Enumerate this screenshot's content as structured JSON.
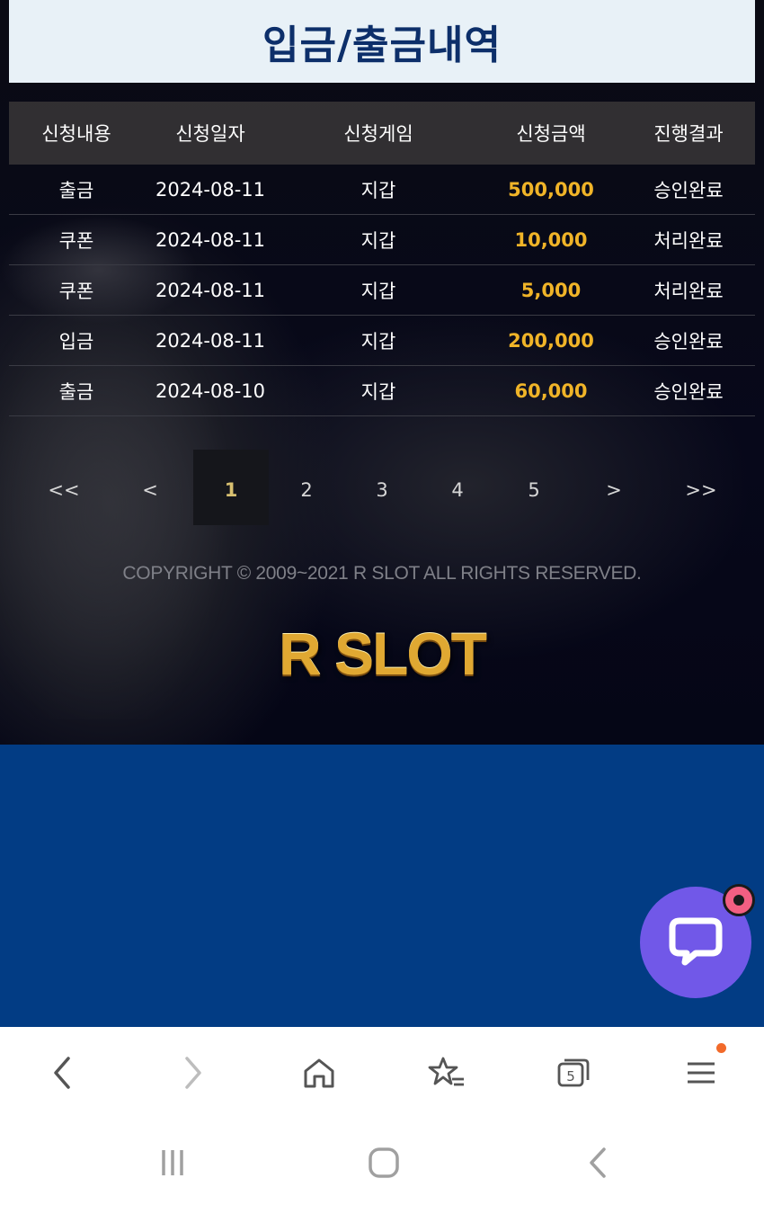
{
  "page_title": "입금/출금내역",
  "table": {
    "headers": [
      "신청내용",
      "신청일자",
      "신청게임",
      "신청금액",
      "진행결과"
    ],
    "rows": [
      {
        "type": "출금",
        "date": "2024-08-11",
        "game": "지갑",
        "amount": "500,000",
        "result": "승인완료"
      },
      {
        "type": "쿠폰",
        "date": "2024-08-11",
        "game": "지갑",
        "amount": "10,000",
        "result": "처리완료"
      },
      {
        "type": "쿠폰",
        "date": "2024-08-11",
        "game": "지갑",
        "amount": "5,000",
        "result": "처리완료"
      },
      {
        "type": "입금",
        "date": "2024-08-11",
        "game": "지갑",
        "amount": "200,000",
        "result": "승인완료"
      },
      {
        "type": "출금",
        "date": "2024-08-10",
        "game": "지갑",
        "amount": "60,000",
        "result": "승인완료"
      }
    ]
  },
  "pagination": {
    "first": "<<",
    "prev": "<",
    "pages": [
      "1",
      "2",
      "3",
      "4",
      "5"
    ],
    "current": "1",
    "next": ">",
    "last": ">>"
  },
  "footer": {
    "copyright": "COPYRIGHT © 2009~2021 R SLOT ALL RIGHTS RESERVED.",
    "logo": "R SLOT"
  },
  "chat": {
    "icon": "chat-bubble-icon",
    "badge_icon": "notification-dot-icon"
  },
  "browser_nav": {
    "icons": [
      "back-arrow-icon",
      "forward-arrow-icon",
      "home-icon",
      "bookmarks-icon",
      "tabs-icon",
      "menu-icon"
    ],
    "tab_count": "5"
  },
  "system_nav": {
    "icons": [
      "recent-apps-icon",
      "home-button-icon",
      "system-back-icon"
    ]
  },
  "colors": {
    "title_bg": "#e8f1f7",
    "title_text": "#0d2f6a",
    "amount": "#f0b428",
    "blue_area": "#023c84",
    "chat_button": "#7158e8",
    "badge": "#f25f82"
  }
}
